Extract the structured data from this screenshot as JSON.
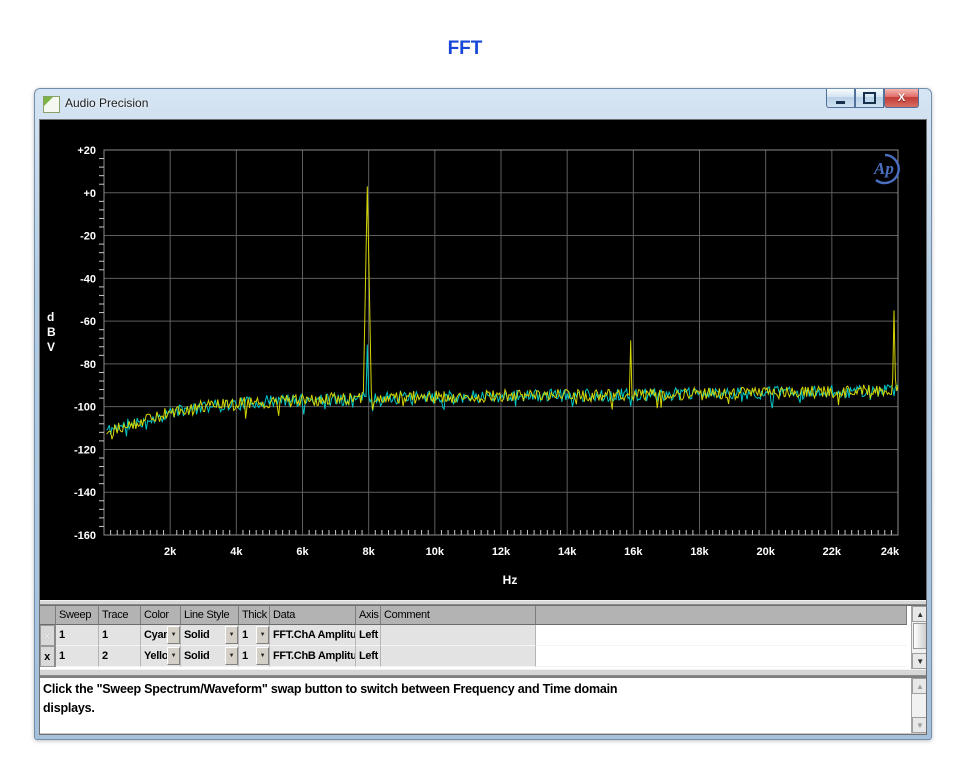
{
  "page_title": "FFT",
  "window": {
    "title": "Audio Precision",
    "close_glyph": "X"
  },
  "icons": {
    "scroll_up": "▲",
    "scroll_down": "▼",
    "dropdown": "▼"
  },
  "chart": {
    "type": "line",
    "xlabel": "Hz",
    "ylabel_letters": "d\nB\nV",
    "logo_text": "Ap",
    "logo_color": "#4a6fc0",
    "background": "#000000",
    "grid": true,
    "grid_color": "#5e5e5e",
    "x_ticks": [
      "2k",
      "4k",
      "6k",
      "8k",
      "10k",
      "12k",
      "14k",
      "16k",
      "18k",
      "20k",
      "22k",
      "24k"
    ],
    "y_ticks": [
      "+20",
      "+0",
      "-20",
      "-40",
      "-60",
      "-80",
      "-100",
      "-120",
      "-140",
      "-160"
    ],
    "x_range_hz": [
      0,
      24000
    ],
    "y_range_db": [
      -160,
      20
    ],
    "series": [
      {
        "name": "FFT.ChA Amplitude",
        "color": "#00c6c6",
        "seed": 11,
        "spikes": [
          {
            "hz": 7960,
            "db": -71
          }
        ]
      },
      {
        "name": "FFT.ChB Amplitude",
        "color": "#d4d400",
        "seed": 29,
        "spikes": [
          {
            "hz": 7960,
            "db": 3
          },
          {
            "hz": 15920,
            "db": -69
          },
          {
            "hz": 23880,
            "db": -55
          }
        ]
      }
    ],
    "noise_floor_db": [
      [
        100,
        -111
      ],
      [
        600,
        -109
      ],
      [
        1200,
        -106.5
      ],
      [
        2000,
        -103
      ],
      [
        3000,
        -100
      ],
      [
        5000,
        -97.5
      ],
      [
        8000,
        -96
      ],
      [
        12000,
        -95
      ],
      [
        16000,
        -94.5
      ],
      [
        20000,
        -93.5
      ],
      [
        24000,
        -92.5
      ]
    ],
    "noise_jitter_db": 3.0
  },
  "trace_table": {
    "headers": [
      "",
      "Sweep",
      "Trace",
      "Color",
      "Line Style",
      "Thick",
      "Data",
      "Axis",
      "Comment"
    ],
    "rows": [
      {
        "selected": "x",
        "selected_style": "dim",
        "sweep": "1",
        "trace": "1",
        "color": "Cyan",
        "line_style": "Solid",
        "thick": "1",
        "data": "FFT.ChA Amplituc",
        "axis": "Left",
        "comment": ""
      },
      {
        "selected": "x",
        "selected_style": "bold",
        "sweep": "1",
        "trace": "2",
        "color": "Yellow",
        "line_style": "Solid",
        "thick": "1",
        "data": "FFT.ChB Amplituc",
        "axis": "Left",
        "comment": ""
      }
    ]
  },
  "comment_box": {
    "text": "Click the \"Sweep Spectrum/Waveform\" swap button to switch between Frequency and Time domain displays."
  }
}
